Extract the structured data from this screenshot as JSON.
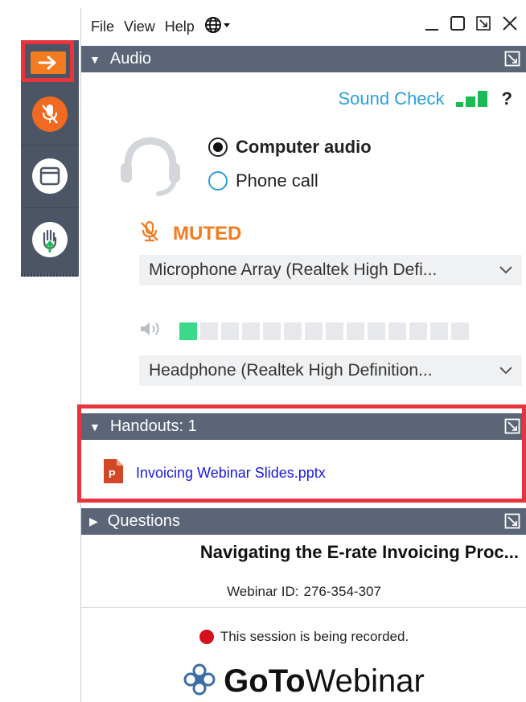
{
  "menubar": {
    "items": [
      "File",
      "View",
      "Help"
    ],
    "language_icon": "globe-icon"
  },
  "window_controls": [
    "minimize-icon",
    "restore-icon",
    "popout-icon",
    "close-icon"
  ],
  "toolbar": {
    "buttons": [
      {
        "icon": "arrow-right-icon",
        "color": "#f47b20"
      },
      {
        "icon": "microphone-muted-icon",
        "color": "#f26a21"
      },
      {
        "icon": "window-icon",
        "color": "#ffffff"
      },
      {
        "icon": "raise-hand-icon",
        "color": "#ffffff"
      }
    ]
  },
  "audio": {
    "header": "Audio",
    "sound_check": "Sound Check",
    "help": "?",
    "options": {
      "computer": "Computer audio",
      "phone": "Phone call",
      "selected": "Computer audio"
    },
    "muted_label": "MUTED",
    "microphone": "Microphone Array (Realtek High Defi...",
    "speaker_level_active": 1,
    "speaker_level_total": 14,
    "headphone": "Headphone (Realtek High Definition..."
  },
  "handouts": {
    "header": "Handouts: 1",
    "file": "Invoicing Webinar Slides.pptx"
  },
  "questions": {
    "header": "Questions"
  },
  "webinar": {
    "title": "Navigating the E-rate Invoicing Proc...",
    "id_label": "Webinar ID:",
    "id": "276-354-307",
    "recording": "This session is being recorded.",
    "brand_bold": "GoTo",
    "brand_light": "Webinar"
  },
  "colors": {
    "accent_orange": "#f47b20",
    "header_bg": "#5b6577",
    "link_blue": "#2aa0d8",
    "highlight_red": "#e8343c",
    "recording_red": "#d4111c"
  }
}
